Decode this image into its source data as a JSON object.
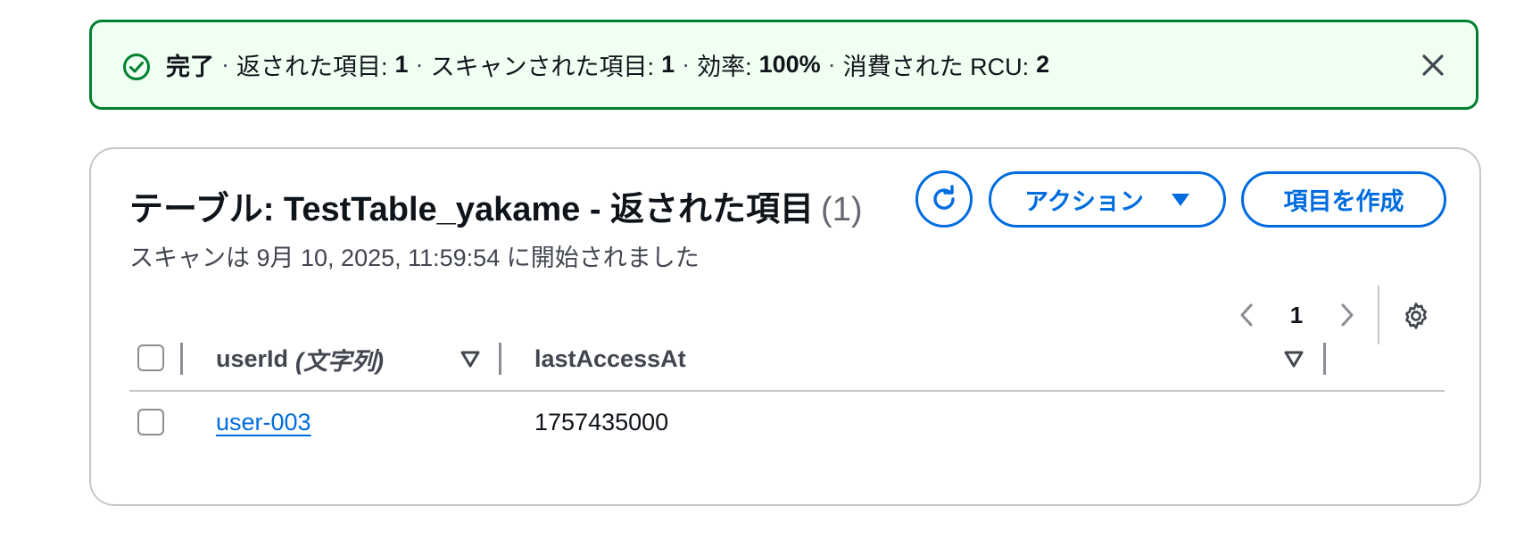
{
  "banner": {
    "status": "完了",
    "returned_label": "返された項目:",
    "returned_value": "1",
    "scanned_label": "スキャンされた項目:",
    "scanned_value": "1",
    "efficiency_label": "効率:",
    "efficiency_value": "100%",
    "rcu_label": "消費された RCU:",
    "rcu_value": "2",
    "separator": "·",
    "icon": "check-circle-icon",
    "success_color": "#00802f"
  },
  "table": {
    "title": "テーブル: TestTable_yakame - 返された項目",
    "count": "(1)",
    "subtitle": "スキャンは 9月 10, 2025, 11:59:54 に開始されました",
    "actions_label": "アクション",
    "create_label": "項目を作成",
    "accent_color": "#006ce0",
    "pagination": {
      "current_page": "1"
    },
    "columns": [
      {
        "name": "userId",
        "type": "(文字列)"
      },
      {
        "name": "lastAccessAt"
      }
    ],
    "rows": [
      {
        "userId": "user-003",
        "lastAccessAt": "1757435000"
      }
    ]
  }
}
